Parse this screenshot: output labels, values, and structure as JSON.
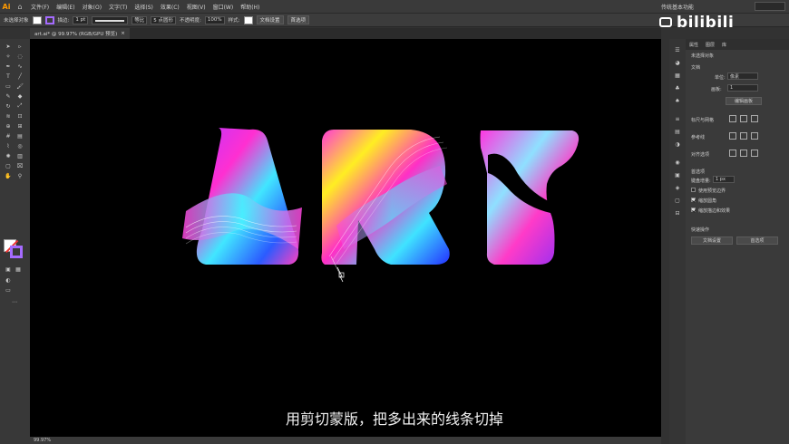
{
  "app": {
    "logo": "Ai",
    "home_icon": "home-icon"
  },
  "menu": [
    "文件(F)",
    "编辑(E)",
    "对象(O)",
    "文字(T)",
    "选择(S)",
    "效果(C)",
    "视图(V)",
    "窗口(W)",
    "帮助(H)"
  ],
  "workspace_label": "传统基本功能",
  "control_bar": {
    "selection_label": "未选择对象",
    "stroke_label": "描边:",
    "stroke_weight": "1 pt",
    "stroke_profile": "等比",
    "brush": "5 点圆形",
    "opacity_label": "不透明度:",
    "opacity_value": "100%",
    "style_label": "样式:",
    "doc_setup": "文档设置",
    "prefs": "首选项"
  },
  "document_tab": {
    "title": "art.ai* @ 99.97% (RGB/GPU 预览)",
    "close": "×"
  },
  "status": {
    "zoom": "99.97%"
  },
  "panel": {
    "tabs": [
      "属性",
      "图层",
      "库"
    ],
    "no_selection": "未选择对象",
    "document": "文档",
    "unit_label": "单位:",
    "unit_value": "像素",
    "artboard_label": "画板:",
    "artboard_value": "1",
    "edit_artboards": "编辑画板",
    "ruler_grid": "标尺与网格",
    "guides": "参考线",
    "snap": "对齐选项",
    "preferences": "首选项",
    "keyboard_inc_label": "键盘增量:",
    "keyboard_inc_value": "1 px",
    "use_preview_bounds": "使用预览边界",
    "scale_corners": "缩放圆角",
    "scale_strokes": "缩放描边和效果",
    "quick_actions": "快速操作",
    "btn_doc_setup": "文档设置",
    "btn_prefs": "首选项"
  },
  "watermark": {
    "text": "bilibili"
  },
  "subtitle": "用剪切蒙版，把多出来的线条切掉",
  "colors": {
    "accent_stroke": "#a56bff",
    "logo": "#ff9a00"
  }
}
